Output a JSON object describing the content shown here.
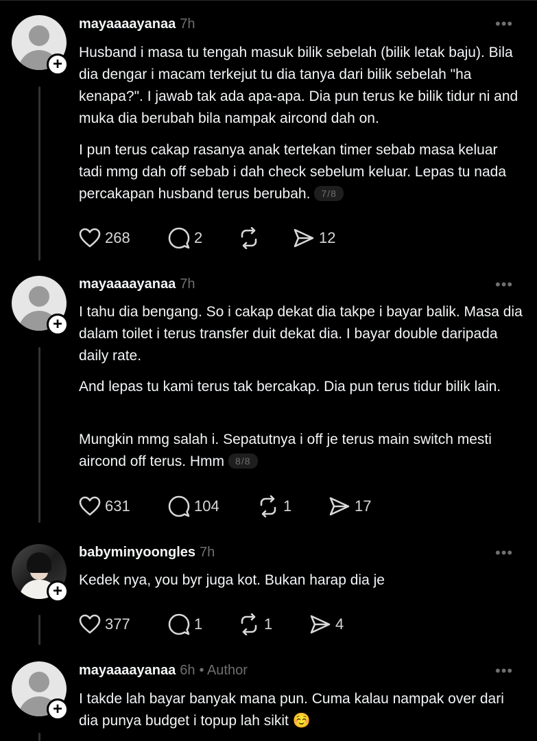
{
  "posts": [
    {
      "username": "mayaaaayanaa",
      "time": "7h",
      "author_tag": "",
      "paragraphs": [
        "Husband i masa tu tengah masuk bilik sebelah (bilik letak baju). Bila dia dengar i macam terkejut tu dia tanya dari bilik sebelah \"ha kenapa?\". I jawab tak ada apa-apa. Dia pun terus ke bilik tidur ni and muka dia berubah bila nampak aircond dah on.",
        "I pun terus cakap rasanya anak tertekan timer sebab masa keluar tadi mmg dah off sebab i dah check sebelum keluar. Lepas tu nada  percakapan husband terus berubah."
      ],
      "page_indicator": "7/8",
      "likes": "268",
      "replies": "2",
      "reposts": "",
      "shares": "12"
    },
    {
      "username": "mayaaaayanaa",
      "time": "7h",
      "author_tag": "",
      "paragraphs": [
        "I tahu dia bengang. So i cakap dekat dia takpe i bayar balik. Masa dia dalam toilet i terus transfer duit dekat dia. I bayar double daripada daily rate.",
        "And lepas tu kami terus tak bercakap. Dia pun terus tidur bilik lain.",
        "Mungkin mmg salah i. Sepatutnya i off je terus main switch mesti aircond off terus. Hmm"
      ],
      "page_indicator": "8/8",
      "likes": "631",
      "replies": "104",
      "reposts": "1",
      "shares": "17"
    },
    {
      "username": "babyminyoongles",
      "time": "7h",
      "author_tag": "",
      "paragraphs": [
        "Kedek nya, you byr juga kot. Bukan harap dia je"
      ],
      "page_indicator": "",
      "likes": "377",
      "replies": "1",
      "reposts": "1",
      "shares": "4"
    },
    {
      "username": "mayaaaayanaa",
      "time": "6h",
      "author_tag": "• Author",
      "paragraphs": [
        "I takde lah bayar banyak mana pun. Cuma kalau nampak over dari dia punya budget i topup lah sikit ☺️"
      ],
      "page_indicator": "",
      "likes": "",
      "replies": "",
      "reposts": "",
      "shares": ""
    }
  ],
  "icons": {
    "more": "more-options-icon",
    "like": "heart-icon",
    "reply": "comment-icon",
    "repost": "repost-icon",
    "share": "send-icon",
    "follow": "plus-icon"
  },
  "colors": {
    "background": "#000000",
    "text": "#f3f5f7",
    "muted": "#6f6f6f"
  }
}
